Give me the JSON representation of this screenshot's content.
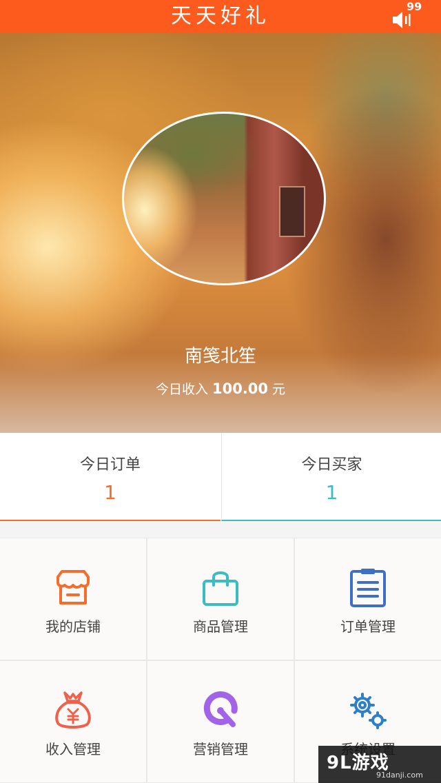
{
  "header": {
    "title": "天天好礼",
    "notification_count": "99",
    "speaker_icon": "speaker-icon",
    "color": "#fd5b1e"
  },
  "profile": {
    "name": "南笺北笙",
    "income_prefix": "今日收入",
    "income_amount": "100.00",
    "income_unit": "元"
  },
  "stats": {
    "orders_label": "今日订单",
    "orders_value": "1",
    "orders_color": "#f36d2d",
    "buyers_label": "今日买家",
    "buyers_value": "1",
    "buyers_color": "#3bbcc0"
  },
  "menu": [
    {
      "label": "我的店铺",
      "icon": "store-icon",
      "color": "#f36d2d"
    },
    {
      "label": "商品管理",
      "icon": "shopping-bag-icon",
      "color": "#3bbcc0"
    },
    {
      "label": "订单管理",
      "icon": "clipboard-list-icon",
      "color": "#3f6fc5"
    },
    {
      "label": "收入管理",
      "icon": "money-bag-icon",
      "color": "#f0614c"
    },
    {
      "label": "营销管理",
      "icon": "marketing-icon",
      "color": "#a163e8"
    },
    {
      "label": "系统设置",
      "icon": "gears-icon",
      "color": "#2f7fc7"
    }
  ],
  "watermark": {
    "main": "9L游戏",
    "sub": "91danji.com"
  }
}
